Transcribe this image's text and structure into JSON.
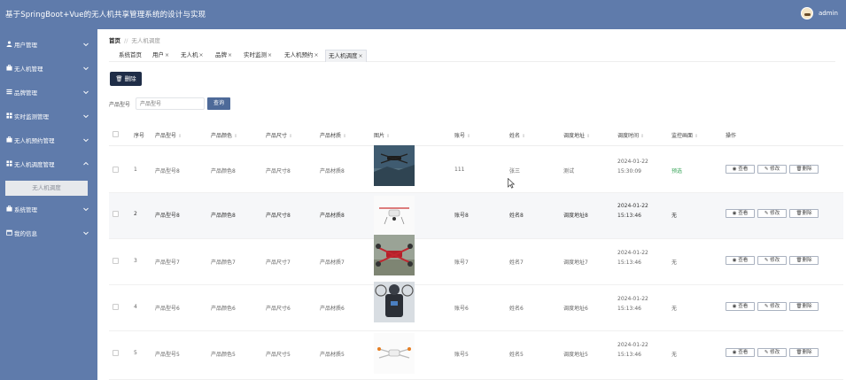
{
  "app": {
    "title": "基于SpringBoot+Vue的无人机共享管理系统的设计与实现",
    "username": "admin"
  },
  "sidebar": {
    "items": [
      {
        "label": "用户管理"
      },
      {
        "label": "无人机管理"
      },
      {
        "label": "品牌管理"
      },
      {
        "label": "实时监测管理"
      },
      {
        "label": "无人机预约管理"
      },
      {
        "label": "无人机调度管理"
      },
      {
        "label": "系统管理"
      },
      {
        "label": "我的信息"
      }
    ],
    "sub_active": "无人机调度"
  },
  "breadcrumb": {
    "home": "首页",
    "separator": "//",
    "current": "无人机调度"
  },
  "tabs": [
    {
      "label": "系统首页"
    },
    {
      "label": "用户"
    },
    {
      "label": "无人机"
    },
    {
      "label": "品牌"
    },
    {
      "label": "实时监测"
    },
    {
      "label": "无人机预约"
    },
    {
      "label": "无人机调度"
    }
  ],
  "toolbar": {
    "delete_label": "删除"
  },
  "search": {
    "label": "产品型号",
    "placeholder": "产品型号",
    "button_label": "查询"
  },
  "table": {
    "headers": [
      "序号",
      "产品型号",
      "产品颜色",
      "产品尺寸",
      "产品材质",
      "图片",
      "账号",
      "姓名",
      "调度地址",
      "调度时间",
      "监控画面",
      "操作"
    ],
    "action_labels": {
      "view": "查看",
      "edit": "修改",
      "delete": "删除"
    },
    "rows": [
      {
        "index": "1",
        "model": "产品型号8",
        "color": "产品颜色8",
        "size": "产品尺寸8",
        "material": "产品材质8",
        "image": "drone-photo",
        "account": "111",
        "name": "张三",
        "address": "测试",
        "time": "2024-01-22 15:30:09",
        "monitor": "预选"
      },
      {
        "index": "2",
        "model": "产品型号8",
        "color": "产品颜色8",
        "size": "产品尺寸8",
        "material": "产品材质8",
        "image": "drone-photo",
        "account": "账号8",
        "name": "姓名8",
        "address": "调度地址8",
        "time": "2024-01-22 15:13:46",
        "monitor": "无"
      },
      {
        "index": "3",
        "model": "产品型号7",
        "color": "产品颜色7",
        "size": "产品尺寸7",
        "material": "产品材质7",
        "image": "drone-photo",
        "account": "账号7",
        "name": "姓名7",
        "address": "调度地址7",
        "time": "2024-01-22 15:13:46",
        "monitor": "无"
      },
      {
        "index": "4",
        "model": "产品型号6",
        "color": "产品颜色6",
        "size": "产品尺寸6",
        "material": "产品材质6",
        "image": "drone-photo",
        "account": "账号6",
        "name": "姓名6",
        "address": "调度地址6",
        "time": "2024-01-22 15:13:46",
        "monitor": "无"
      },
      {
        "index": "5",
        "model": "产品型号5",
        "color": "产品颜色5",
        "size": "产品尺寸5",
        "material": "产品材质5",
        "image": "drone-photo",
        "account": "账号5",
        "name": "姓名5",
        "address": "调度地址5",
        "time": "2024-01-22 15:13:46",
        "monitor": "无"
      }
    ]
  },
  "colors": {
    "sidebar": "#5f7bab",
    "topbar": "#5f7bab",
    "primary_dark": "#1f2d47",
    "search_button": "#4e6a99",
    "ok_status": "#3aa55a"
  }
}
